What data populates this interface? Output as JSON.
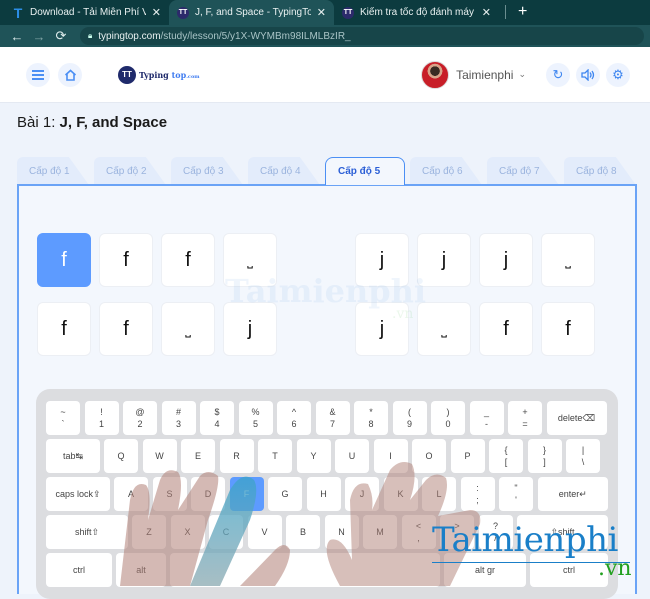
{
  "browser": {
    "tabs": [
      {
        "title": "Download - Tải Miễn Phí VN - Ph",
        "favicon": "taimienphi-t-icon",
        "active": false
      },
      {
        "title": "J, F, and Space - TypingTop",
        "favicon": "typingtop-icon",
        "active": true
      },
      {
        "title": "Kiểm tra tốc độ đánh máy tiếng \\",
        "favicon": "typingtop-icon",
        "active": false
      }
    ],
    "close_glyph": "✕",
    "new_tab_glyph": "+",
    "url_host": "typingtop.com",
    "url_path": "/study/lesson/5/y1X-WYMBm98ILMLBzIR_"
  },
  "header": {
    "logo_text": "Typing",
    "logo_accent": "top",
    "logo_suffix": ".com",
    "username": "Taimienphi"
  },
  "lesson": {
    "prefix": "Bài 1: ",
    "title": "J, F, and Space"
  },
  "levels": [
    "Cấp độ 1",
    "Cấp độ 2",
    "Cấp độ 3",
    "Cấp độ 4",
    "Cấp độ 5",
    "Cấp độ 6",
    "Cấp độ 7",
    "Cấp độ 8"
  ],
  "active_level_index": 4,
  "exercise": {
    "current_index": 0,
    "characters": [
      "f",
      "f",
      "f",
      "⎵",
      "j",
      "j",
      "j",
      "⎵",
      "f",
      "f",
      "⎵",
      "j",
      "j",
      "⎵",
      "f",
      "f"
    ]
  },
  "keyboard": {
    "highlighted_key": "F",
    "row1": [
      [
        "~",
        "`"
      ],
      [
        "!",
        "1"
      ],
      [
        "@",
        "2"
      ],
      [
        "#",
        "3"
      ],
      [
        "$",
        "4"
      ],
      [
        "%",
        "5"
      ],
      [
        "^",
        "6"
      ],
      [
        "&",
        "7"
      ],
      [
        "*",
        "8"
      ],
      [
        "(",
        "9"
      ],
      [
        ")",
        "0"
      ],
      [
        "_",
        "-"
      ],
      [
        "+",
        "="
      ]
    ],
    "delete_label": "delete⌫",
    "tab_label": "tab↹",
    "row2": [
      "Q",
      "W",
      "E",
      "R",
      "T",
      "Y",
      "U",
      "I",
      "O",
      "P"
    ],
    "row2_sym": [
      [
        "{",
        "["
      ],
      [
        "}",
        "]"
      ],
      [
        "|",
        "\\"
      ]
    ],
    "caps_label": "caps lock⇪",
    "row3": [
      "A",
      "S",
      "D",
      "F",
      "G",
      "H",
      "J",
      "K",
      "L"
    ],
    "row3_sym": [
      [
        ":",
        ";"
      ],
      [
        "\"",
        "'"
      ]
    ],
    "enter_label": "enter↵",
    "shift_label": "shift⇧",
    "row4": [
      "Z",
      "X",
      "C",
      "V",
      "B",
      "N",
      "M"
    ],
    "row4_sym": [
      [
        "<",
        ","
      ],
      [
        ">",
        "."
      ],
      [
        "?",
        "/"
      ]
    ],
    "rshift_label": "⇧shift",
    "ctrl_label": "ctrl",
    "alt_label": "alt",
    "altgr_label": "alt gr"
  },
  "watermark": {
    "text": "Taimienphi",
    "suffix": ".vn"
  }
}
